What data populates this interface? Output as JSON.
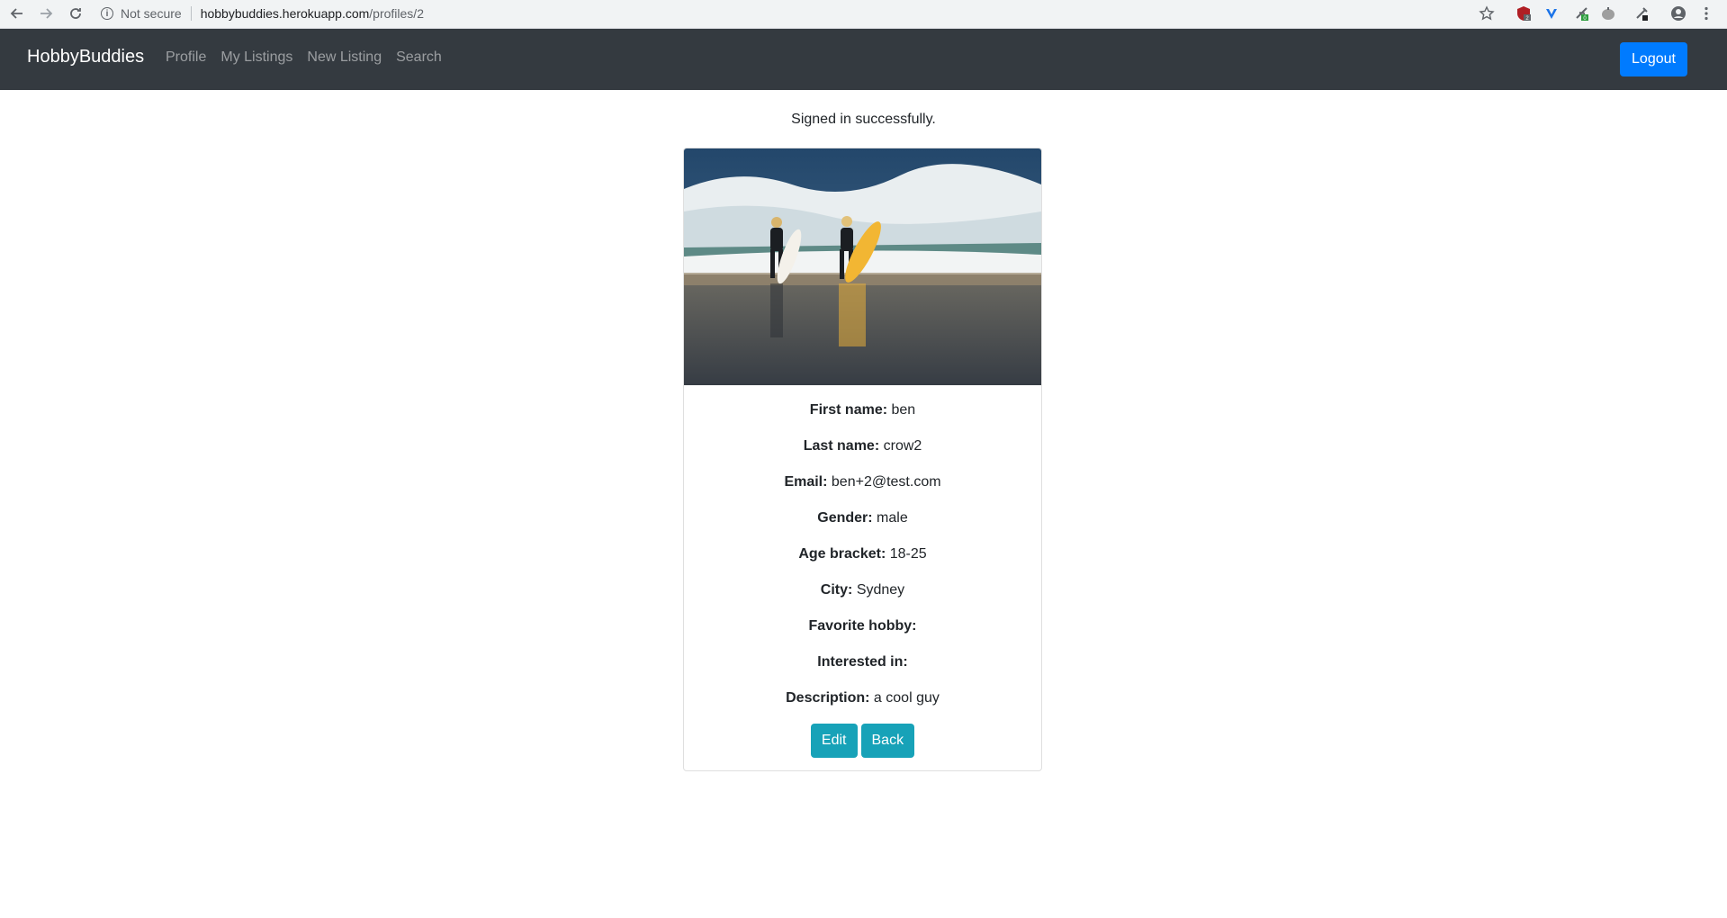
{
  "browser": {
    "security_label": "Not secure",
    "url_host": "hobbybuddies.herokuapp.com",
    "url_path": "/profiles/2",
    "ext_badge_1": "2",
    "ext_badge_2": "0"
  },
  "navbar": {
    "brand": "HobbyBuddies",
    "links": [
      "Profile",
      "My Listings",
      "New Listing",
      "Search"
    ],
    "logout_label": "Logout",
    "accent_color": "#007bff",
    "background_color": "#343a40"
  },
  "flash": "Signed in successfully.",
  "profile": {
    "image_alt": "surfers-photo",
    "fields": [
      {
        "label": "First name:",
        "value": "ben"
      },
      {
        "label": "Last name:",
        "value": "crow2"
      },
      {
        "label": "Email:",
        "value": "ben+2@test.com"
      },
      {
        "label": "Gender:",
        "value": "male"
      },
      {
        "label": "Age bracket:",
        "value": "18-25"
      },
      {
        "label": "City:",
        "value": "Sydney"
      },
      {
        "label": "Favorite hobby:",
        "value": ""
      },
      {
        "label": "Interested in:",
        "value": ""
      },
      {
        "label": "Description:",
        "value": "a cool guy"
      }
    ],
    "edit_label": "Edit",
    "back_label": "Back",
    "button_color": "#17a2b8"
  }
}
